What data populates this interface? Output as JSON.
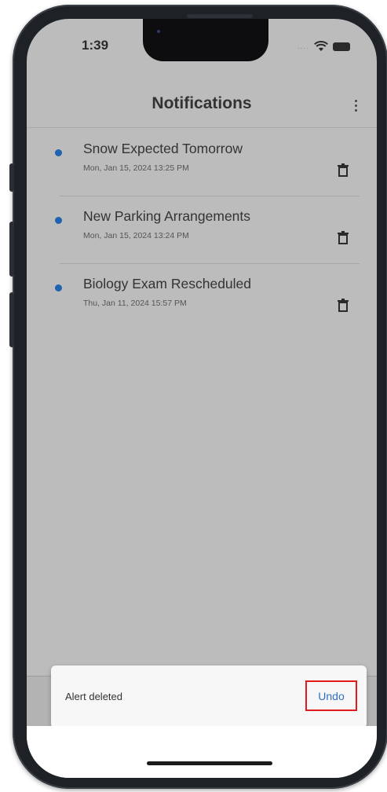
{
  "status_bar": {
    "time": "1:39",
    "signal_text": "....",
    "icons": [
      "wifi-icon",
      "battery-icon"
    ]
  },
  "header": {
    "title": "Notifications",
    "menu_icon": "more-vert-icon"
  },
  "notifications": [
    {
      "title": "Snow Expected Tomorrow",
      "date": "Mon, Jan 15, 2024 13:25 PM",
      "unread": true
    },
    {
      "title": "New Parking Arrangements",
      "date": "Mon, Jan 15, 2024 13:24 PM",
      "unread": true
    },
    {
      "title": "Biology Exam Rescheduled",
      "date": "Thu, Jan 11, 2024 15:57 PM",
      "unread": true
    }
  ],
  "snackbar": {
    "message": "Alert deleted",
    "action_label": "Undo"
  },
  "colors": {
    "unread_dot": "#1f62b0",
    "undo_text": "#2f6fc0",
    "highlight_border": "#e11b1b",
    "screen_dim": "#bcbcbc"
  }
}
